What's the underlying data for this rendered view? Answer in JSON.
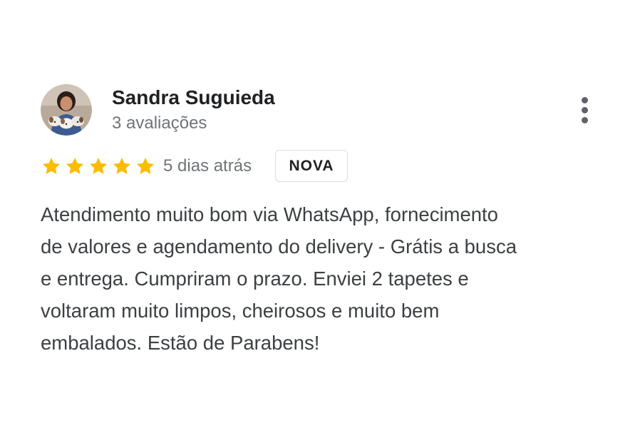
{
  "review": {
    "author": {
      "name": "Sandra Suguieda",
      "reviews_count": "3 avaliações",
      "avatar_icon": "user-photo-avatar"
    },
    "more_options_icon": "three-dots-vertical-icon",
    "rating": {
      "value": 5,
      "max": 5,
      "star_color": "#fbbc04"
    },
    "time": "5 dias atrás",
    "badge": "NOVA",
    "text_lines": [
      "Atendimento muito bom via WhatsApp, fornecimento",
      "de valores e agendamento do delivery - Grátis a busca",
      "e entrega. Cumpriram o prazo. Enviei 2 tapetes e",
      "voltaram muito limpos, cheirosos e muito bem",
      "embalados. Estão de Parabens!"
    ]
  },
  "colors": {
    "name_text": "#202124",
    "secondary_text": "#70757a",
    "body_text": "#3c4043",
    "badge_border": "#dadce0",
    "icon_gray": "#5f6368"
  }
}
